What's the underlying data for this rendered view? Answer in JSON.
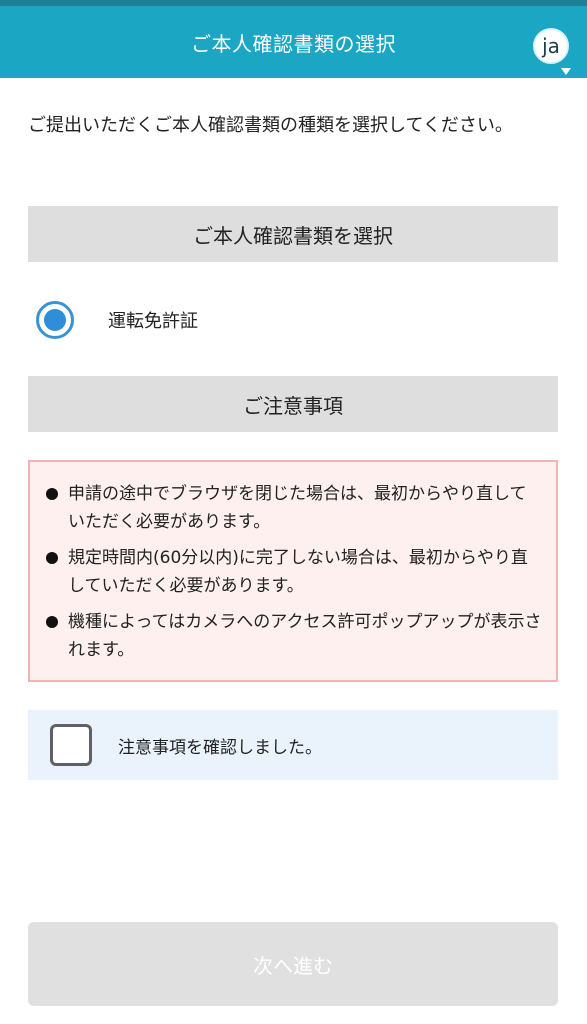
{
  "header": {
    "title": "ご本人確認書類の選択",
    "language_label": "ja"
  },
  "intro_text": "ご提出いただくご本人確認書類の種類を選択してください。",
  "document_section": {
    "heading": "ご本人確認書類を選択",
    "options": [
      {
        "label": "運転免許証",
        "selected": true
      }
    ]
  },
  "notes_section": {
    "heading": "ご注意事項",
    "items": [
      "申請の途中でブラウザを閉じた場合は、最初からやり直していただく必要があります。",
      "規定時間内(60分以内)に完了しない場合は、最初からやり直していただく必要があります。",
      "機種によってはカメラへのアクセス許可ポップアップが表示されます。"
    ]
  },
  "confirmation": {
    "label": "注意事項を確認しました。",
    "checked": false
  },
  "next_button": {
    "label": "次へ進む",
    "enabled": false
  },
  "colors": {
    "header_bg": "#1ba6c4",
    "radio_accent": "#2f8ed7",
    "notice_bg": "#fdf0ef",
    "notice_border": "#f2b5b5",
    "confirm_bg": "#eaf3fc",
    "button_disabled_bg": "#e0e0e0"
  },
  "icons": {
    "language": "language-selector-icon",
    "radio": "radio-selected-icon",
    "checkbox": "checkbox-unchecked-icon"
  }
}
